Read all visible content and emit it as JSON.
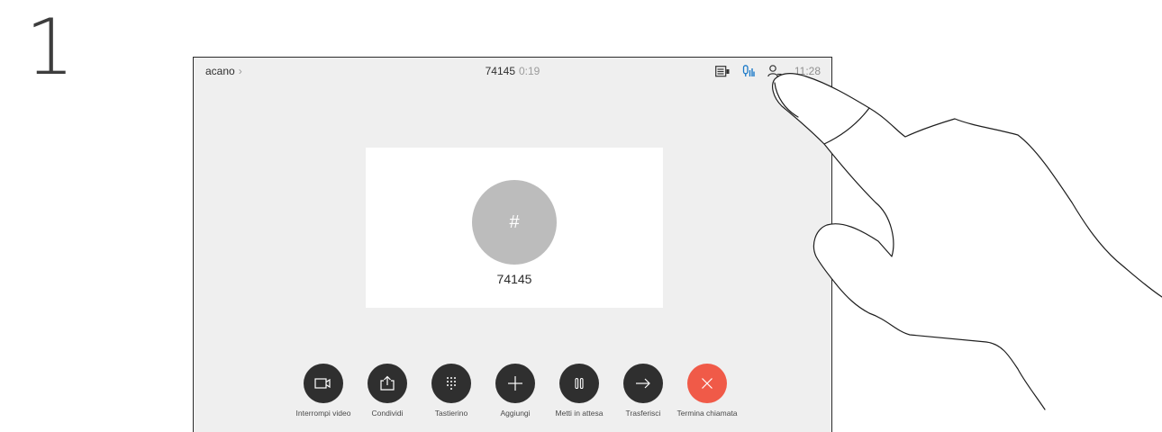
{
  "step": {
    "number": "1"
  },
  "topbar": {
    "call_name": "acano",
    "chevron": "›",
    "number": "74145",
    "duration": "0:19",
    "time": "11:28",
    "icons": [
      "layout-icon",
      "audio-level-icon",
      "participants-icon"
    ],
    "accent_color": "#1a79c8"
  },
  "card": {
    "avatar_glyph": "#",
    "number": "74145"
  },
  "controls": [
    {
      "label": "Interrompi video",
      "icon": "video-camera-icon",
      "color": "#2f2f2f"
    },
    {
      "label": "Condividi",
      "icon": "share-icon",
      "color": "#2f2f2f"
    },
    {
      "label": "Tastierino",
      "icon": "keypad-icon",
      "color": "#2f2f2f"
    },
    {
      "label": "Aggiungi",
      "icon": "plus-icon",
      "color": "#2f2f2f"
    },
    {
      "label": "Metti in attesa",
      "icon": "pause-icon",
      "color": "#2f2f2f"
    },
    {
      "label": "Trasferisci",
      "icon": "arrow-right-icon",
      "color": "#2f2f2f"
    },
    {
      "label": "Termina chiamata",
      "icon": "close-icon",
      "color": "#f05a48"
    }
  ]
}
